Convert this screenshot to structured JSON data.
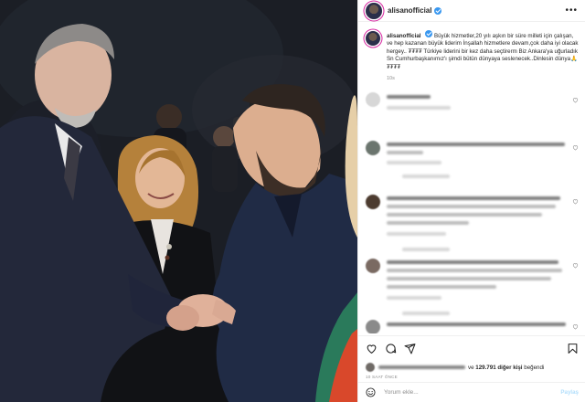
{
  "post": {
    "username": "alisanofficial",
    "caption_text": "Büyük hizmetler,20 yılı aşkın bir süre milleti için çalışan, ve hep kazanan büyük liderim İnşallah hizmetlere devam,çok daha iyi olacak hergey.. ₮₮₮₮ Türkiye liderini bir kez daha seçtirerm Biz Ankara'ya uğurladık Sn Cumhurbaşkanımız'ı şimdi bütün dünyaya seslenecek..Dinlesin dünya🙏₮₮₮₮",
    "caption_time": "10s",
    "more_icon": "•••"
  },
  "likes": {
    "text": "ve 129.791 diğer kişi beğendi",
    "prefix": "ve ",
    "count_text": "129.791 diğer kişi",
    "suffix": " beğendi"
  },
  "time_ago": "10 SAAT ÖNCE",
  "comment_box": {
    "placeholder": "Yorum ekle...",
    "post_label": "Paylaş"
  },
  "icons": {
    "like": "heart-icon",
    "comment": "comment-icon",
    "share": "share-icon",
    "save": "bookmark-icon",
    "emoji": "emoji-icon"
  },
  "colors": {
    "verified": "#3897f0",
    "post_button": "#b2dffc",
    "secondary_text": "#8e8e8e"
  }
}
